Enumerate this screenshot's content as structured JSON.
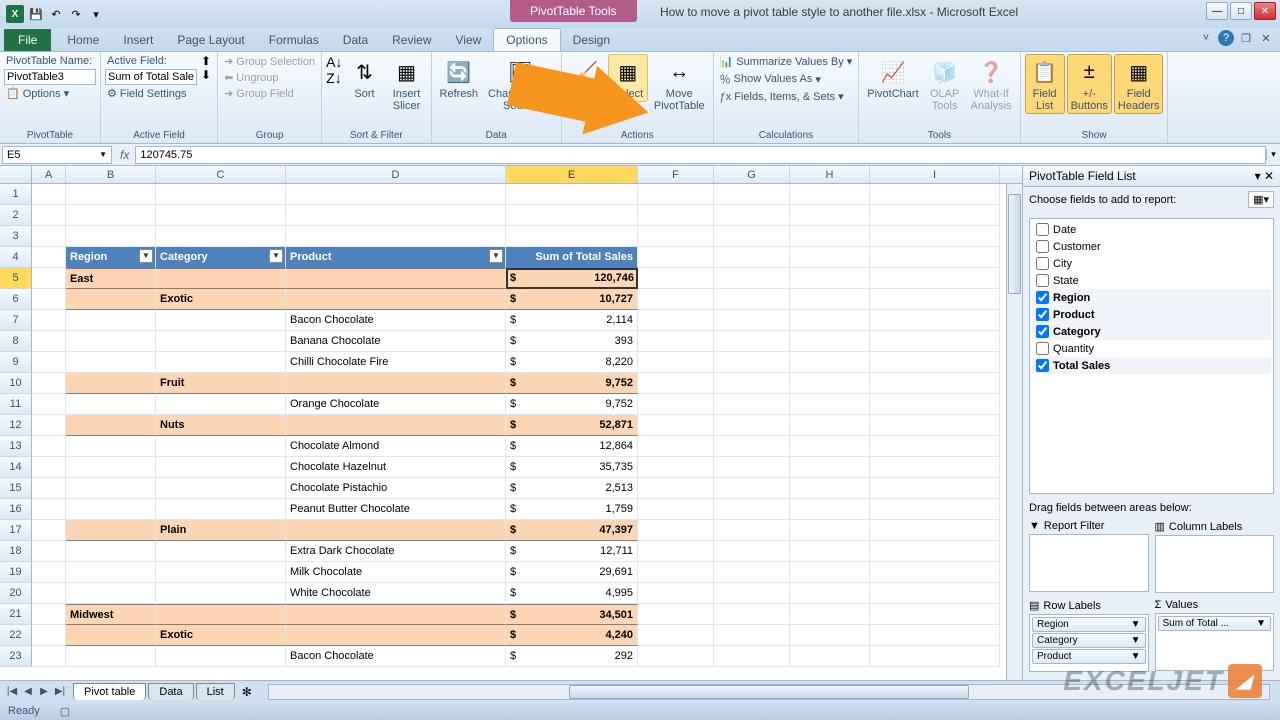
{
  "window": {
    "tool_context": "PivotTable Tools",
    "title": "How to move a pivot table style to another file.xlsx - Microsoft Excel"
  },
  "ribbon": {
    "tabs": [
      "File",
      "Home",
      "Insert",
      "Page Layout",
      "Formulas",
      "Data",
      "Review",
      "View",
      "Options",
      "Design"
    ],
    "active_tab": "Options",
    "pivot": {
      "name_label": "PivotTable Name:",
      "name_value": "PivotTable3",
      "options_label": "Options",
      "group_label": "PivotTable"
    },
    "active_field": {
      "label": "Active Field:",
      "value": "Sum of Total Sales",
      "field_settings": "Field Settings",
      "group_label": "Active Field"
    },
    "group": {
      "group_selection": "Group Selection",
      "ungroup": "Ungroup",
      "group_field": "Group Field",
      "group_label": "Group"
    },
    "sort_filter": {
      "sort": "Sort",
      "insert_slicer": "Insert\nSlicer",
      "group_label": "Sort & Filter"
    },
    "data": {
      "refresh": "Refresh",
      "change_source": "Change Data\nSource",
      "group_label": "Data"
    },
    "actions": {
      "clear": "Clear",
      "select": "Select",
      "move": "Move\nPivotTable",
      "group_label": "Actions"
    },
    "calculations": {
      "summarize": "Summarize Values By",
      "show_as": "Show Values As",
      "fields": "Fields, Items, & Sets",
      "group_label": "Calculations"
    },
    "tools": {
      "pivotchart": "PivotChart",
      "olap": "OLAP\nTools",
      "whatif": "What-If\nAnalysis",
      "group_label": "Tools"
    },
    "show": {
      "field_list": "Field\nList",
      "buttons": "+/-\nButtons",
      "headers": "Field\nHeaders",
      "group_label": "Show"
    }
  },
  "formula_bar": {
    "name_box": "E5",
    "formula": "120745.75"
  },
  "columns": [
    "A",
    "B",
    "C",
    "D",
    "E",
    "F",
    "G",
    "H",
    "I"
  ],
  "pivot_table": {
    "headers": {
      "region": "Region",
      "category": "Category",
      "product": "Product",
      "sum": "Sum of Total Sales"
    },
    "rows": [
      {
        "r": 5,
        "type": "region",
        "label": "East",
        "val": "120,746",
        "selected": true
      },
      {
        "r": 6,
        "type": "category",
        "label": "Exotic",
        "val": "10,727"
      },
      {
        "r": 7,
        "type": "product",
        "label": "Bacon Chocolate",
        "val": "2,114"
      },
      {
        "r": 8,
        "type": "product",
        "label": "Banana Chocolate",
        "val": "393"
      },
      {
        "r": 9,
        "type": "product",
        "label": "Chilli Chocolate Fire",
        "val": "8,220"
      },
      {
        "r": 10,
        "type": "category",
        "label": "Fruit",
        "val": "9,752"
      },
      {
        "r": 11,
        "type": "product",
        "label": "Orange Chocolate",
        "val": "9,752"
      },
      {
        "r": 12,
        "type": "category",
        "label": "Nuts",
        "val": "52,871"
      },
      {
        "r": 13,
        "type": "product",
        "label": "Chocolate Almond",
        "val": "12,864"
      },
      {
        "r": 14,
        "type": "product",
        "label": "Chocolate Hazelnut",
        "val": "35,735"
      },
      {
        "r": 15,
        "type": "product",
        "label": "Chocolate Pistachio",
        "val": "2,513"
      },
      {
        "r": 16,
        "type": "product",
        "label": "Peanut Butter Chocolate",
        "val": "1,759"
      },
      {
        "r": 17,
        "type": "category",
        "label": "Plain",
        "val": "47,397"
      },
      {
        "r": 18,
        "type": "product",
        "label": "Extra Dark Chocolate",
        "val": "12,711"
      },
      {
        "r": 19,
        "type": "product",
        "label": "Milk Chocolate",
        "val": "29,691"
      },
      {
        "r": 20,
        "type": "product",
        "label": "White Chocolate",
        "val": "4,995"
      },
      {
        "r": 21,
        "type": "region",
        "label": "Midwest",
        "val": "34,501"
      },
      {
        "r": 22,
        "type": "category",
        "label": "Exotic",
        "val": "4,240"
      },
      {
        "r": 23,
        "type": "product",
        "label": "Bacon Chocolate",
        "val": "292"
      }
    ]
  },
  "field_list": {
    "title": "PivotTable Field List",
    "prompt": "Choose fields to add to report:",
    "fields": [
      {
        "name": "Date",
        "checked": false
      },
      {
        "name": "Customer",
        "checked": false
      },
      {
        "name": "City",
        "checked": false
      },
      {
        "name": "State",
        "checked": false
      },
      {
        "name": "Region",
        "checked": true
      },
      {
        "name": "Product",
        "checked": true
      },
      {
        "name": "Category",
        "checked": true
      },
      {
        "name": "Quantity",
        "checked": false
      },
      {
        "name": "Total Sales",
        "checked": true
      }
    ],
    "areas_prompt": "Drag fields between areas below:",
    "report_filter": "Report Filter",
    "column_labels": "Column Labels",
    "row_labels": "Row Labels",
    "values": "Values",
    "row_items": [
      "Region",
      "Category",
      "Product"
    ],
    "value_items": [
      "Sum of Total ..."
    ]
  },
  "sheets": {
    "tabs": [
      "Pivot table",
      "Data",
      "List"
    ],
    "active": 0
  },
  "status": {
    "ready": "Ready"
  },
  "watermark": "EXCELJET"
}
